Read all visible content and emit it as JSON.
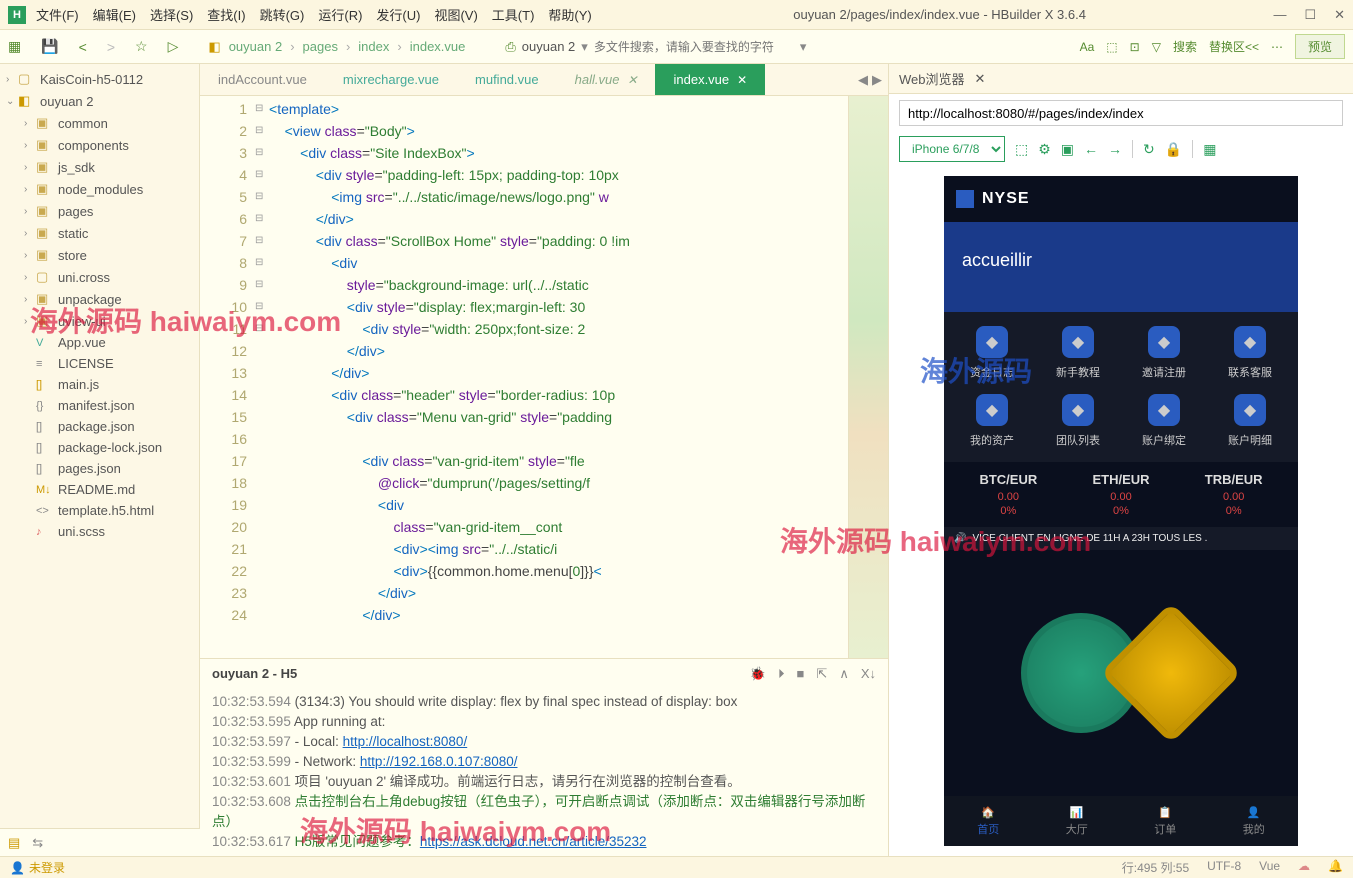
{
  "window": {
    "title": "ouyuan 2/pages/index/index.vue - HBuilder X 3.6.4",
    "logo": "H"
  },
  "menubar": [
    "文件(F)",
    "编辑(E)",
    "选择(S)",
    "查找(I)",
    "跳转(G)",
    "运行(R)",
    "发行(U)",
    "视图(V)",
    "工具(T)",
    "帮助(Y)"
  ],
  "breadcrumb": [
    "ouyuan 2",
    "pages",
    "index",
    "index.vue"
  ],
  "toolbar": {
    "project_dropdown": "ouyuan 2",
    "search_placeholder": "多文件搜索，请输入要查找的字符",
    "search_btn": "搜索",
    "replace_btn": "替换区<<",
    "preview_btn": "预览"
  },
  "tree": {
    "root1": "KaisCoin-h5-0112",
    "root2": "ouyuan 2",
    "folders": [
      "common",
      "components",
      "js_sdk",
      "node_modules",
      "pages",
      "static",
      "store",
      "unpackage",
      "uview-ui"
    ],
    "file_uni": "uni.cross",
    "files": [
      {
        "icon": "V",
        "name": "App.vue",
        "color": "#4a9"
      },
      {
        "icon": "≡",
        "name": "LICENSE",
        "color": "#888"
      },
      {
        "icon": "[]",
        "name": "main.js",
        "color": "#c90"
      },
      {
        "icon": "{}",
        "name": "manifest.json",
        "color": "#888"
      },
      {
        "icon": "[]",
        "name": "package.json",
        "color": "#888"
      },
      {
        "icon": "[]",
        "name": "package-lock.json",
        "color": "#888"
      },
      {
        "icon": "[]",
        "name": "pages.json",
        "color": "#888"
      },
      {
        "icon": "M↓",
        "name": "README.md",
        "color": "#c90"
      },
      {
        "icon": "<>",
        "name": "template.h5.html",
        "color": "#888"
      },
      {
        "icon": "♪",
        "name": "uni.scss",
        "color": "#d66"
      }
    ]
  },
  "tabs": [
    {
      "label": "indAccount.vue",
      "cls": ""
    },
    {
      "label": "mixrecharge.vue",
      "cls": "green"
    },
    {
      "label": "mufind.vue",
      "cls": "green"
    },
    {
      "label": "hall.vue",
      "cls": "italic",
      "closable": true
    },
    {
      "label": "index.vue",
      "cls": "active"
    }
  ],
  "code_lines": [
    {
      "n": 1,
      "f": "⊟",
      "html": "<span class='punct'>&lt;</span><span class='tag'>template</span><span class='punct'>&gt;</span>"
    },
    {
      "n": 2,
      "f": "⊟",
      "html": "    <span class='punct'>&lt;</span><span class='tag'>view</span> <span class='attr'>class</span>=<span class='str'>\"Body\"</span><span class='punct'>&gt;</span>"
    },
    {
      "n": 3,
      "f": "⊟",
      "html": "        <span class='punct'>&lt;</span><span class='tag'>div</span> <span class='attr'>class</span>=<span class='str'>\"Site IndexBox\"</span><span class='punct'>&gt;</span>"
    },
    {
      "n": 4,
      "f": "⊟",
      "html": "            <span class='punct'>&lt;</span><span class='tag'>div</span> <span class='attr'>style</span>=<span class='str'>\"padding-left: 15px; padding-top: 10px</span>"
    },
    {
      "n": 5,
      "f": "",
      "html": "                <span class='punct'>&lt;</span><span class='tag'>img</span> <span class='attr'>src</span>=<span class='str'>\"../../static/image/news/logo.png\"</span> <span class='attr'>w</span>"
    },
    {
      "n": 6,
      "f": "",
      "html": "            <span class='punct'>&lt;/</span><span class='tag'>div</span><span class='punct'>&gt;</span>"
    },
    {
      "n": 7,
      "f": "⊟",
      "html": "            <span class='punct'>&lt;</span><span class='tag'>div</span> <span class='attr'>class</span>=<span class='str'>\"ScrollBox Home\"</span> <span class='attr'>style</span>=<span class='str'>\"padding: 0 !im</span>"
    },
    {
      "n": 8,
      "f": "⊟",
      "html": "                <span class='punct'>&lt;</span><span class='tag'>div</span>"
    },
    {
      "n": 9,
      "f": "",
      "html": "                    <span class='attr'>style</span>=<span class='str'>\"background-image: url(../../static</span>"
    },
    {
      "n": 10,
      "f": "⊟",
      "html": "                    <span class='punct'>&lt;</span><span class='tag'>div</span> <span class='attr'>style</span>=<span class='str'>\"display: flex;margin-left: 30</span>"
    },
    {
      "n": 11,
      "f": "",
      "html": "                        <span class='punct'>&lt;</span><span class='tag'>div</span> <span class='attr'>style</span>=<span class='str'>\"width: 250px;font-size: 2</span>"
    },
    {
      "n": 12,
      "f": "",
      "html": "                    <span class='punct'>&lt;/</span><span class='tag'>div</span><span class='punct'>&gt;</span>"
    },
    {
      "n": 13,
      "f": "",
      "html": "                <span class='punct'>&lt;/</span><span class='tag'>div</span><span class='punct'>&gt;</span>"
    },
    {
      "n": 14,
      "f": "⊟",
      "html": "                <span class='punct'>&lt;</span><span class='tag'>div</span> <span class='attr'>class</span>=<span class='str'>\"header\"</span> <span class='attr'>style</span>=<span class='str'>\"border-radius: 10p</span>"
    },
    {
      "n": 15,
      "f": "⊟",
      "html": "                    <span class='punct'>&lt;</span><span class='tag'>div</span> <span class='attr'>class</span>=<span class='str'>\"Menu van-grid\"</span> <span class='attr'>style</span>=<span class='str'>\"padding</span>"
    },
    {
      "n": 16,
      "f": "",
      "html": ""
    },
    {
      "n": 17,
      "f": "⊟",
      "html": "                        <span class='punct'>&lt;</span><span class='tag'>div</span> <span class='attr'>class</span>=<span class='str'>\"van-grid-item\"</span> <span class='attr'>style</span>=<span class='str'>\"fle</span>"
    },
    {
      "n": 18,
      "f": "",
      "html": "                            <span class='attr'>@click</span>=<span class='str'>\"dumprun('/pages/setting/f</span>"
    },
    {
      "n": 19,
      "f": "⊟",
      "html": "                            <span class='punct'>&lt;</span><span class='tag'>div</span>"
    },
    {
      "n": 20,
      "f": "",
      "html": "                                <span class='attr'>class</span>=<span class='str'>\"van-grid-item__cont</span>"
    },
    {
      "n": 21,
      "f": "",
      "html": "                                <span class='punct'>&lt;</span><span class='tag'>div</span><span class='punct'>&gt;&lt;</span><span class='tag'>img</span> <span class='attr'>src</span>=<span class='str'>\"../../static/i</span>"
    },
    {
      "n": 22,
      "f": "",
      "html": "                                <span class='punct'>&lt;</span><span class='tag'>div</span><span class='punct'>&gt;</span>{{common.home.menu[<span class='str'>0</span>]}}<span class='punct'>&lt;</span>"
    },
    {
      "n": 23,
      "f": "",
      "html": "                            <span class='punct'>&lt;/</span><span class='tag'>div</span><span class='punct'>&gt;</span>"
    },
    {
      "n": 24,
      "f": "",
      "html": "                        <span class='punct'>&lt;/</span><span class='tag'>div</span><span class='punct'>&gt;</span>"
    }
  ],
  "console": {
    "title": "ouyuan 2 - H5",
    "lines": [
      {
        "ts": "10:32:53.594",
        "text": "(3134:3) You should write display: flex by final spec instead of display: box"
      },
      {
        "ts": "10:32:53.595",
        "text": "  App running at:"
      },
      {
        "ts": "10:32:53.597",
        "text": "  - Local:   ",
        "link": "http://localhost:8080/"
      },
      {
        "ts": "10:32:53.599",
        "text": "  - Network: ",
        "link": "http://192.168.0.107:8080/"
      },
      {
        "ts": "10:32:53.601",
        "text": "项目 'ouyuan 2' 编译成功。前端运行日志，请另行在浏览器的控制台查看。"
      },
      {
        "ts": "10:32:53.608",
        "green": "点击控制台右上角debug按钮（红色虫子），可开启断点调试（添加断点：双击编辑器行号添加断点）"
      },
      {
        "ts": "10:32:53.617",
        "green": "H5版常见问题参考：",
        "link": "https://ask.dcloud.net.cn/article/35232"
      }
    ]
  },
  "browser": {
    "tab_label": "Web浏览器",
    "url": "http://localhost:8080/#/pages/index/index",
    "device": "iPhone 6/7/8"
  },
  "phone": {
    "brand": "NYSE",
    "banner": "accueillir",
    "grid": [
      "资金日志",
      "新手教程",
      "邀请注册",
      "联系客服",
      "我的资产",
      "团队列表",
      "账户绑定",
      "账户明细"
    ],
    "tickers": [
      {
        "pair": "BTC/EUR",
        "val": "0.00",
        "pct": "0%"
      },
      {
        "pair": "ETH/EUR",
        "val": "0.00",
        "pct": "0%"
      },
      {
        "pair": "TRB/EUR",
        "val": "0.00",
        "pct": "0%"
      }
    ],
    "marquee": "VICE CLIENT EN LIGNE DE 11H A 23H TOUS LES .",
    "nav": [
      {
        "label": "首页",
        "active": true
      },
      {
        "label": "大厅"
      },
      {
        "label": "订单"
      },
      {
        "label": "我的"
      }
    ]
  },
  "statusbar": {
    "login": "未登录",
    "pos": "行:495  列:55",
    "enc": "UTF-8",
    "lang": "Vue"
  },
  "watermark": "海外源码 haiwaiym.com"
}
